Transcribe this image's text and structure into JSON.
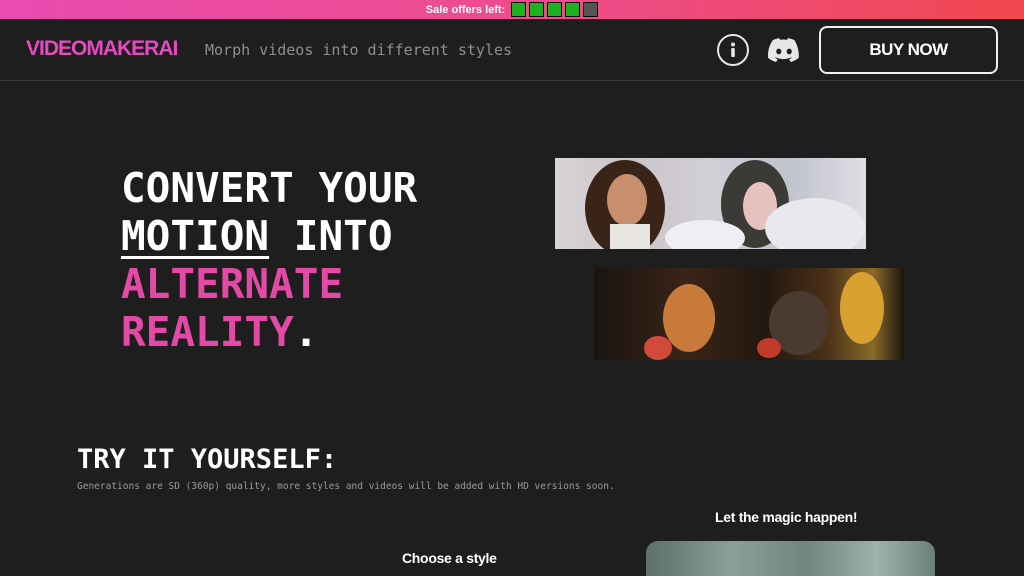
{
  "sale_bar": {
    "label": "Sale offers left:",
    "slots": [
      {
        "state": "available",
        "color": "#1fb21f"
      },
      {
        "state": "available",
        "color": "#1fb21f"
      },
      {
        "state": "available",
        "color": "#1fb21f"
      },
      {
        "state": "available",
        "color": "#1fb21f"
      },
      {
        "state": "sold",
        "color": "#555555"
      }
    ]
  },
  "header": {
    "logo": "VIDEOMAKERAI",
    "tagline": "Morph videos into different styles",
    "info_icon": "info-icon",
    "discord_icon": "discord-icon",
    "buy_button": "BUY NOW"
  },
  "hero": {
    "line1": "CONVERT YOUR",
    "line2_underlined": "MOTION",
    "line2_rest": " INTO",
    "line3": "ALTERNATE",
    "line4": "REALITY",
    "line4_period": "."
  },
  "try_section": {
    "title": "TRY IT YOURSELF:",
    "description": "Generations are SD (360p) quality, more styles and videos will be added with HD versions soon."
  },
  "demo": {
    "magic_label": "Let the magic happen!",
    "choose_label": "Choose a style"
  },
  "colors": {
    "accent": "#e24aa6",
    "background": "#1e1e1e"
  }
}
